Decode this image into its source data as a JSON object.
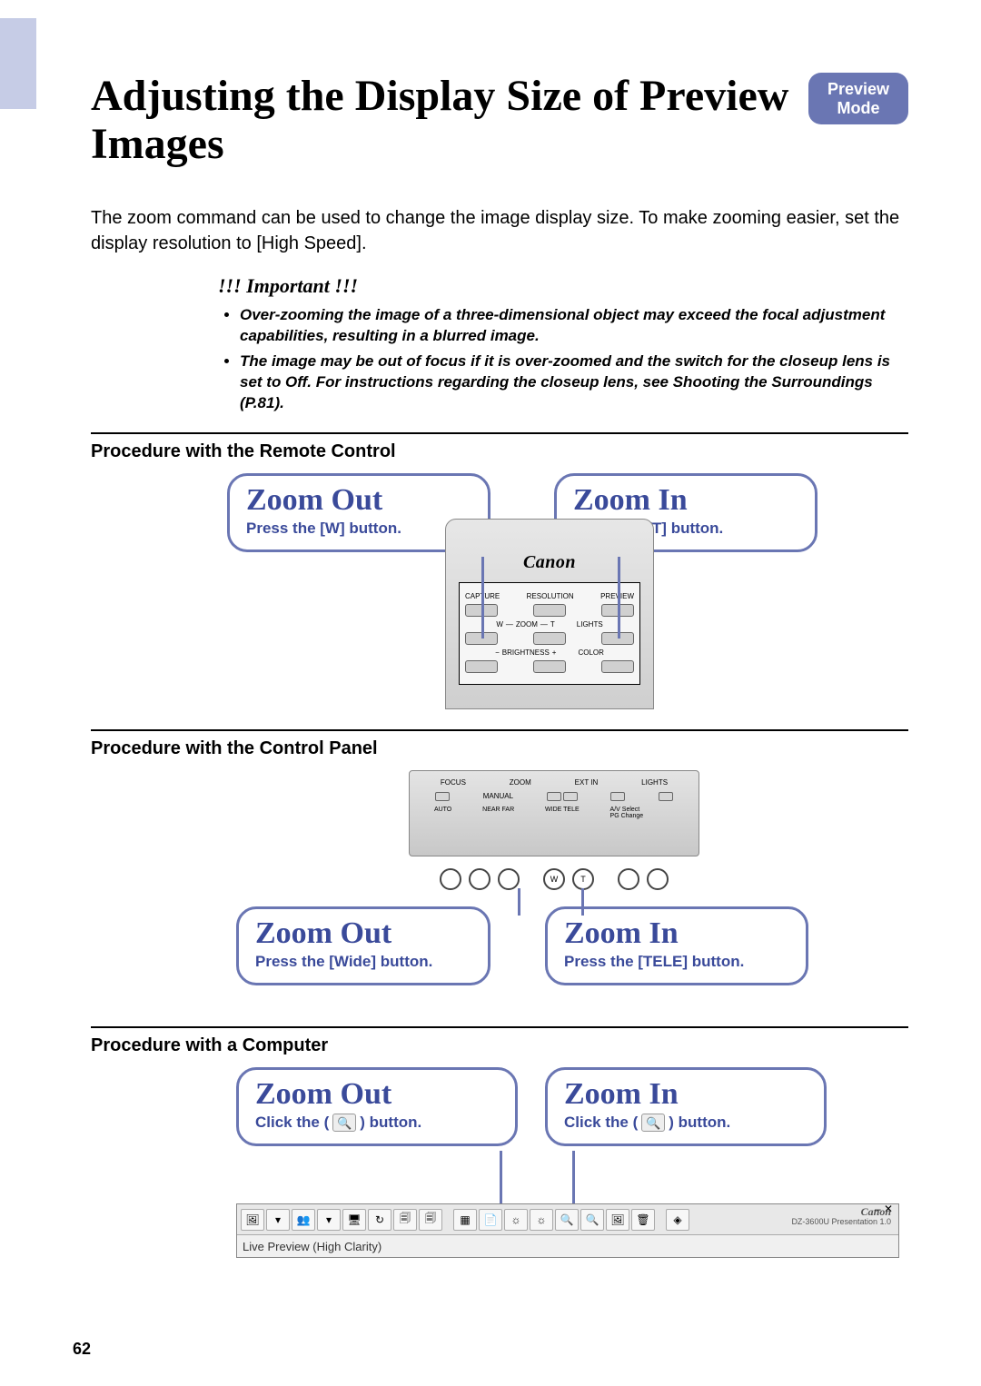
{
  "page_number": "62",
  "title": "Adjusting the Display Size of Preview Images",
  "mode_badge": {
    "line1": "Preview",
    "line2": "Mode"
  },
  "intro": "The zoom command can be used to change the image display size. To make zooming easier, set the display resolution to [High Speed].",
  "important": {
    "heading": "!!! Important !!!",
    "bullets": [
      "Over-zooming the image of a three-dimensional object may exceed the focal adjustment capabilities, resulting in a blurred image.",
      "The image may be out of focus if it is over-zoomed and the switch for the closeup lens is set to Off. For instructions regarding the closeup lens, see Shooting the Surroundings (P.81)."
    ]
  },
  "sections": {
    "remote": {
      "title": "Procedure with the Remote Control",
      "logo": "Canon",
      "zoom_out": {
        "title": "Zoom Out",
        "sub": "Press the [W] button."
      },
      "zoom_in": {
        "title": "Zoom In",
        "sub": "Press the [T] button."
      },
      "labels": {
        "capture": "CAPTURE",
        "resolution": "RESOLUTION",
        "preview": "PREVIEW",
        "zoom": "ZOOM",
        "w": "W",
        "t": "T",
        "lights": "LIGHTS",
        "brightness": "BRIGHTNESS",
        "minus": "−",
        "plus": "+",
        "color": "COLOR"
      }
    },
    "panel": {
      "title": "Procedure with the Control Panel",
      "zoom_out": {
        "title": "Zoom Out",
        "sub": "Press the [Wide] button."
      },
      "zoom_in": {
        "title": "Zoom In",
        "sub": "Press the [TELE] button."
      },
      "labels": {
        "focus": "FOCUS",
        "zoom": "ZOOM",
        "extin": "EXT IN",
        "lights": "LIGHTS",
        "auto": "AUTO",
        "manual": "MANUAL",
        "near": "NEAR",
        "far": "FAR",
        "wide": "WIDE",
        "tele": "TELE",
        "avselect": "A/V Select",
        "pgchange": "PG Change",
        "w": "W",
        "t": "T"
      }
    },
    "computer": {
      "title": "Procedure with a Computer",
      "zoom_out": {
        "title": "Zoom Out",
        "sub_pre": "Click the (",
        "sub_post": ") button."
      },
      "zoom_in": {
        "title": "Zoom In",
        "sub_pre": "Click the (",
        "sub_post": ") button."
      },
      "status_bar": "Live Preview (High Clarity)",
      "brand": "Canon",
      "brand_sub": "DZ-3600U\nPresentation 1.0"
    }
  }
}
